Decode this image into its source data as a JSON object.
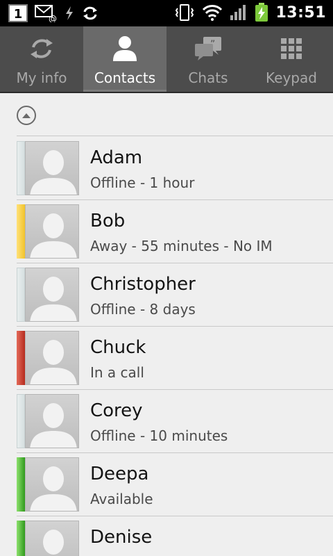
{
  "status_bar": {
    "notification_count": "1",
    "time": "13:51"
  },
  "tabs": [
    {
      "label": "My info",
      "icon": "sync-icon",
      "active": false
    },
    {
      "label": "Contacts",
      "icon": "person-icon",
      "active": true
    },
    {
      "label": "Chats",
      "icon": "chat-bubbles-icon",
      "active": false
    },
    {
      "label": "Keypad",
      "icon": "keypad-icon",
      "active": false
    }
  ],
  "contacts": [
    {
      "name": "Adam",
      "status": "Offline - 1 hour",
      "presence": "offline"
    },
    {
      "name": "Bob",
      "status": "Away - 55 minutes - No IM",
      "presence": "away"
    },
    {
      "name": "Christopher",
      "status": "Offline - 8 days",
      "presence": "offline"
    },
    {
      "name": "Chuck",
      "status": "In a call",
      "presence": "busy"
    },
    {
      "name": "Corey",
      "status": "Offline - 10 minutes",
      "presence": "offline"
    },
    {
      "name": "Deepa",
      "status": "Available",
      "presence": "available"
    },
    {
      "name": "Denise",
      "status": "",
      "presence": "available"
    }
  ],
  "colors": {
    "tab_bar": "#4c4c4c",
    "tab_active": "#6a6a6a",
    "list_background": "#efefef",
    "away": "#f1c32a",
    "busy": "#b52a1d",
    "available": "#2f9a1c",
    "offline": "#d6dfe0"
  }
}
